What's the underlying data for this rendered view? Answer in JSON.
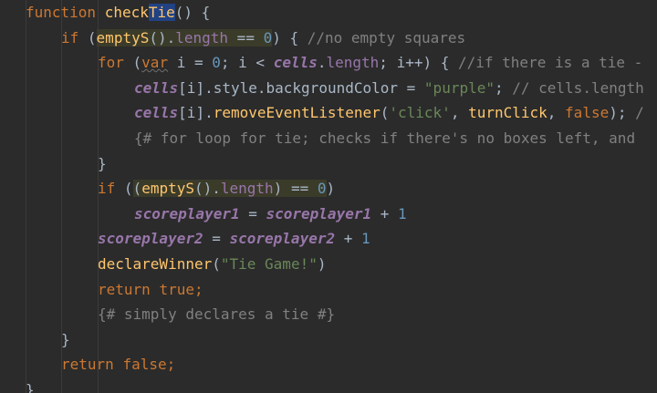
{
  "code": {
    "lines": [
      {
        "tokens": [
          {
            "t": "function ",
            "c": "kw"
          },
          {
            "t": "check",
            "c": "fn"
          },
          {
            "t": "Tie",
            "c": "fn hlsel"
          },
          {
            "t": "() {",
            "c": "pl"
          }
        ]
      },
      {
        "tokens": [
          {
            "t": "if ",
            "c": "kw"
          },
          {
            "t": "(",
            "c": "pl"
          },
          {
            "t": "emptyS",
            "c": "fn hl"
          },
          {
            "t": "().",
            "c": "pl hl"
          },
          {
            "t": "length",
            "c": "fld hl"
          },
          {
            "t": " == ",
            "c": "pl hl"
          },
          {
            "t": "0",
            "c": "num hl"
          },
          {
            "t": ") { ",
            "c": "pl"
          },
          {
            "t": "//no empty squares",
            "c": "cm"
          }
        ]
      },
      {
        "tokens": [
          {
            "t": "for ",
            "c": "kw"
          },
          {
            "t": "(",
            "c": "pl"
          },
          {
            "t": "var",
            "c": "kw squig"
          },
          {
            "t": " i = ",
            "c": "pl"
          },
          {
            "t": "0",
            "c": "num"
          },
          {
            "t": "; i < ",
            "c": "pl"
          },
          {
            "t": "cells",
            "c": "var"
          },
          {
            "t": ".",
            "c": "pl"
          },
          {
            "t": "length",
            "c": "fld"
          },
          {
            "t": "; i++) { ",
            "c": "pl"
          },
          {
            "t": "//if there is a tie -",
            "c": "cm"
          }
        ]
      },
      {
        "tokens": [
          {
            "t": "cells",
            "c": "var"
          },
          {
            "t": "[i].",
            "c": "pl"
          },
          {
            "t": "style",
            "c": "pl"
          },
          {
            "t": ".",
            "c": "pl"
          },
          {
            "t": "backgroundColor",
            "c": "pl"
          },
          {
            "t": " = ",
            "c": "pl"
          },
          {
            "t": "\"purple\"",
            "c": "str"
          },
          {
            "t": "; ",
            "c": "pl"
          },
          {
            "t": "// cells.length",
            "c": "cm"
          }
        ]
      },
      {
        "tokens": [
          {
            "t": "cells",
            "c": "var"
          },
          {
            "t": "[i].",
            "c": "pl"
          },
          {
            "t": "removeEventListener",
            "c": "fn"
          },
          {
            "t": "(",
            "c": "pl"
          },
          {
            "t": "'click'",
            "c": "str"
          },
          {
            "t": ", ",
            "c": "pl"
          },
          {
            "t": "turnClick",
            "c": "fn"
          },
          {
            "t": ", ",
            "c": "pl"
          },
          {
            "t": "false",
            "c": "kw"
          },
          {
            "t": "); ",
            "c": "pl"
          },
          {
            "t": "/",
            "c": "cm"
          }
        ]
      },
      {
        "tokens": [
          {
            "t": "{# for loop for tie; checks if there's no boxes left, and",
            "c": "cm"
          }
        ]
      },
      {
        "tokens": [
          {
            "t": "}",
            "c": "pl"
          }
        ]
      },
      {
        "tokens": [
          {
            "t": "if ",
            "c": "kw"
          },
          {
            "t": "(",
            "c": "pl"
          },
          {
            "t": "(",
            "c": "pl hl"
          },
          {
            "t": "emptyS",
            "c": "fn hl"
          },
          {
            "t": "().",
            "c": "pl hl"
          },
          {
            "t": "length",
            "c": "fld hl"
          },
          {
            "t": ") == ",
            "c": "pl hl"
          },
          {
            "t": "0",
            "c": "num hl"
          },
          {
            "t": ")",
            "c": "pl"
          }
        ]
      },
      {
        "tokens": [
          {
            "t": "scoreplayer1",
            "c": "var"
          },
          {
            "t": " = ",
            "c": "pl"
          },
          {
            "t": "scoreplayer1",
            "c": "var"
          },
          {
            "t": " + ",
            "c": "pl"
          },
          {
            "t": "1",
            "c": "num"
          }
        ]
      },
      {
        "tokens": [
          {
            "t": "scoreplayer2",
            "c": "var"
          },
          {
            "t": " = ",
            "c": "pl"
          },
          {
            "t": "scoreplayer2",
            "c": "var"
          },
          {
            "t": " + ",
            "c": "pl"
          },
          {
            "t": "1",
            "c": "num"
          }
        ]
      },
      {
        "tokens": [
          {
            "t": "declareWinner",
            "c": "fn"
          },
          {
            "t": "(",
            "c": "pl"
          },
          {
            "t": "\"Tie Game!\"",
            "c": "str"
          },
          {
            "t": ")",
            "c": "pl"
          }
        ]
      },
      {
        "tokens": [
          {
            "t": "return ",
            "c": "kw"
          },
          {
            "t": "true",
            "c": "kw"
          },
          {
            "t": ";",
            "c": "kw"
          }
        ]
      },
      {
        "tokens": [
          {
            "t": "{# simply declares a tie #}",
            "c": "cm"
          }
        ]
      },
      {
        "tokens": [
          {
            "t": "}",
            "c": "pl"
          }
        ]
      },
      {
        "tokens": [
          {
            "t": "return ",
            "c": "kw"
          },
          {
            "t": "false",
            "c": "kw"
          },
          {
            "t": ";",
            "c": "kw"
          }
        ]
      },
      {
        "tokens": [
          {
            "t": "}",
            "c": "pl"
          }
        ]
      }
    ]
  },
  "colors": {
    "background": "#2b2b2b",
    "keyword": "#cc7832",
    "function": "#ffc66d",
    "variable": "#9876aa",
    "string": "#6a8759",
    "number": "#6897bb",
    "comment": "#808080",
    "plain": "#a9b7c6"
  }
}
